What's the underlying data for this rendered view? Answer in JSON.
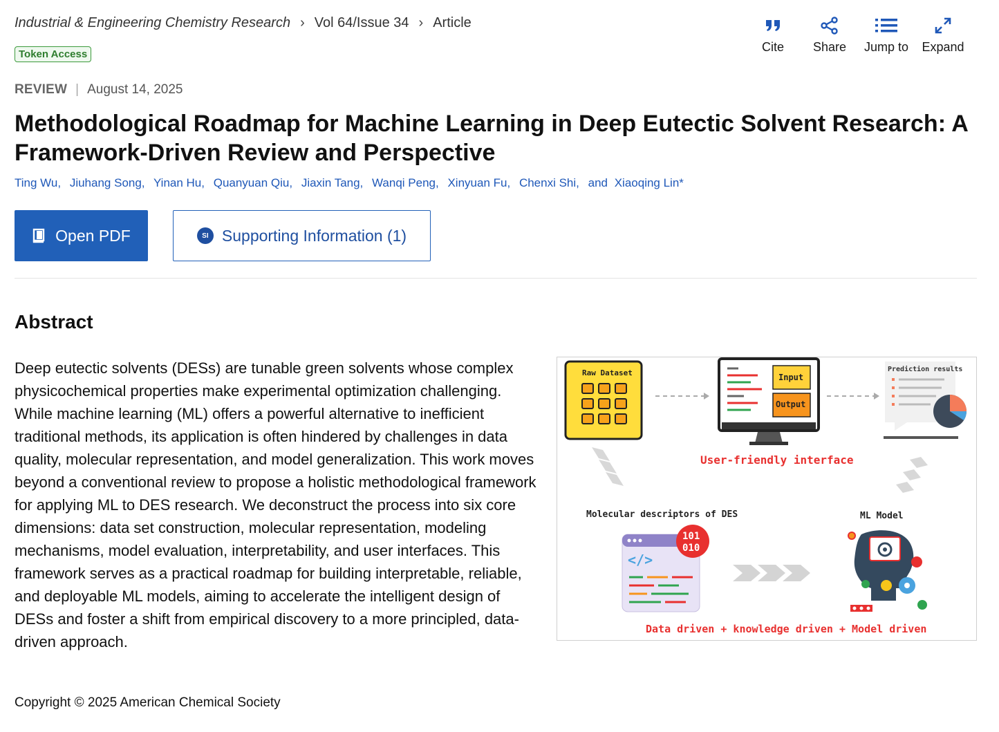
{
  "breadcrumb": {
    "journal": "Industrial & Engineering Chemistry Research",
    "issue": "Vol 64/Issue 34",
    "section": "Article"
  },
  "badge": "Token Access",
  "toolbar": {
    "cite": "Cite",
    "share": "Share",
    "jump": "Jump to",
    "expand": "Expand"
  },
  "meta": {
    "type": "REVIEW",
    "date": "August 14, 2025"
  },
  "title": "Methodological Roadmap for Machine Learning in Deep Eutectic Solvent Research: A Framework-Driven Review and Perspective",
  "authors": [
    "Ting Wu,",
    "Jiuhang Song,",
    "Yinan Hu,",
    "Quanyuan Qiu,",
    "Jiaxin Tang,",
    "Wanqi Peng,",
    "Xinyuan Fu,",
    "Chenxi Shi,",
    "and",
    "Xiaoqing Lin*"
  ],
  "actions": {
    "pdf": "Open PDF",
    "si_icon": "SI",
    "si": "Supporting Information (1)"
  },
  "abstract": {
    "heading": "Abstract",
    "text": "Deep eutectic solvents (DESs) are tunable green solvents whose complex physicochemical properties make experimental optimization challenging. While machine learning (ML) offers a powerful alternative to inefficient traditional methods, its application is often hindered by challenges in data quality, molecular representation, and model generalization. This work moves beyond a conventional review to propose a holistic methodological framework for applying ML to DES research. We deconstruct the process into six core dimensions: data set construction, molecular representation, modeling mechanisms, model evaluation, interpretability, and user interfaces. This framework serves as a practical roadmap for building interpretable, reliable, and deployable ML models, aiming to accelerate the intelligent design of DESs and foster a shift from empirical discovery to a more principled, data-driven approach."
  },
  "toc_graphic": {
    "raw_dataset": "Raw Dataset",
    "input": "Input",
    "output": "Output",
    "prediction": "Prediction results",
    "ui_caption": "User-friendly interface",
    "descriptors": "Molecular descriptors of DES",
    "ml_model": "ML Model",
    "binary_1": "101",
    "binary_2": "010",
    "code_tag": "</>",
    "footer": "Data driven + knowledge driven + Model driven"
  },
  "colors": {
    "link": "#1f58b8",
    "primary_button": "#2160b8",
    "badge_green": "#3b9a3b",
    "toc_red": "#e8302f"
  },
  "copyright": "Copyright © 2025 American Chemical Society"
}
